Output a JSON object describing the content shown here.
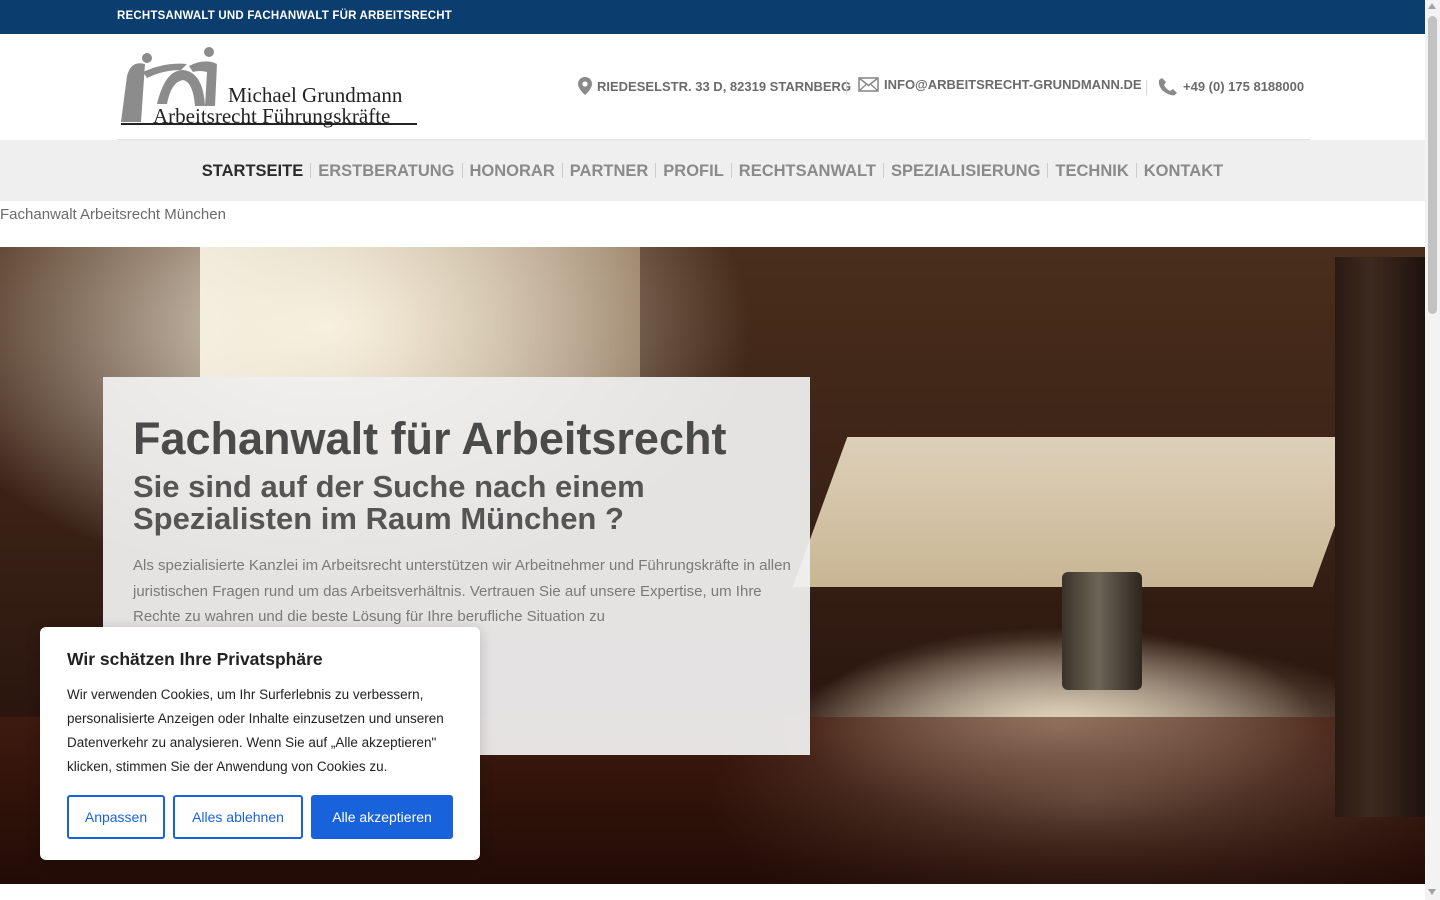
{
  "topbar": {
    "text": "RECHTSANWALT UND FACHANWALT FÜR ARBEITSRECHT"
  },
  "logo": {
    "name": "Michael Grundmann",
    "tagline": "Arbeitsrecht Führungskräfte"
  },
  "contact": {
    "address": "RIEDESELSTR. 33 D, 82319 STARNBERG",
    "email": "INFO@ARBEITSRECHT-GRUNDMANN.DE",
    "phone": "+49 (0) 175 8188000",
    "icons": [
      "map-pin-icon",
      "envelope-icon",
      "phone-icon"
    ]
  },
  "nav": {
    "items": [
      {
        "label": "STARTSEITE",
        "active": true
      },
      {
        "label": "ERSTBERATUNG"
      },
      {
        "label": "HONORAR"
      },
      {
        "label": "PARTNER"
      },
      {
        "label": "PROFIL"
      },
      {
        "label": "RECHTSANWALT"
      },
      {
        "label": "SPEZIALISIERUNG"
      },
      {
        "label": "TECHNIK"
      },
      {
        "label": "KONTAKT"
      }
    ]
  },
  "page": {
    "subtitle": "Fachanwalt Arbeitsrecht München"
  },
  "hero": {
    "title": "Fachanwalt für Arbeitsrecht",
    "subtitle": "Sie sind auf der Suche nach einem Spezialisten im Raum München ?",
    "text": "Als spezialisierte Kanzlei im Arbeitsrecht unterstützen wir Arbeitnehmer und Führungskräfte in allen juristischen Fragen rund um das Arbeitsverhältnis. Vertrauen Sie auf unsere Expertise, um Ihre Rechte zu wahren und die beste Lösung für Ihre berufliche Situation zu"
  },
  "cookie": {
    "title": "Wir schätzen Ihre Privatsphäre",
    "text": "Wir verwenden Cookies, um Ihr Surferlebnis zu verbessern, personalisierte Anzeigen oder Inhalte einzusetzen und unseren Datenverkehr zu analysieren. Wenn Sie auf „Alle akzeptieren\" klicken, stimmen Sie der Anwendung von Cookies zu.",
    "customize_label": "Anpassen",
    "reject_label": "Alles ablehnen",
    "accept_label": "Alle akzeptieren"
  },
  "colors": {
    "topbar": "#0b3d6e",
    "accent": "#1863dc",
    "nav_bg": "#efefef"
  }
}
